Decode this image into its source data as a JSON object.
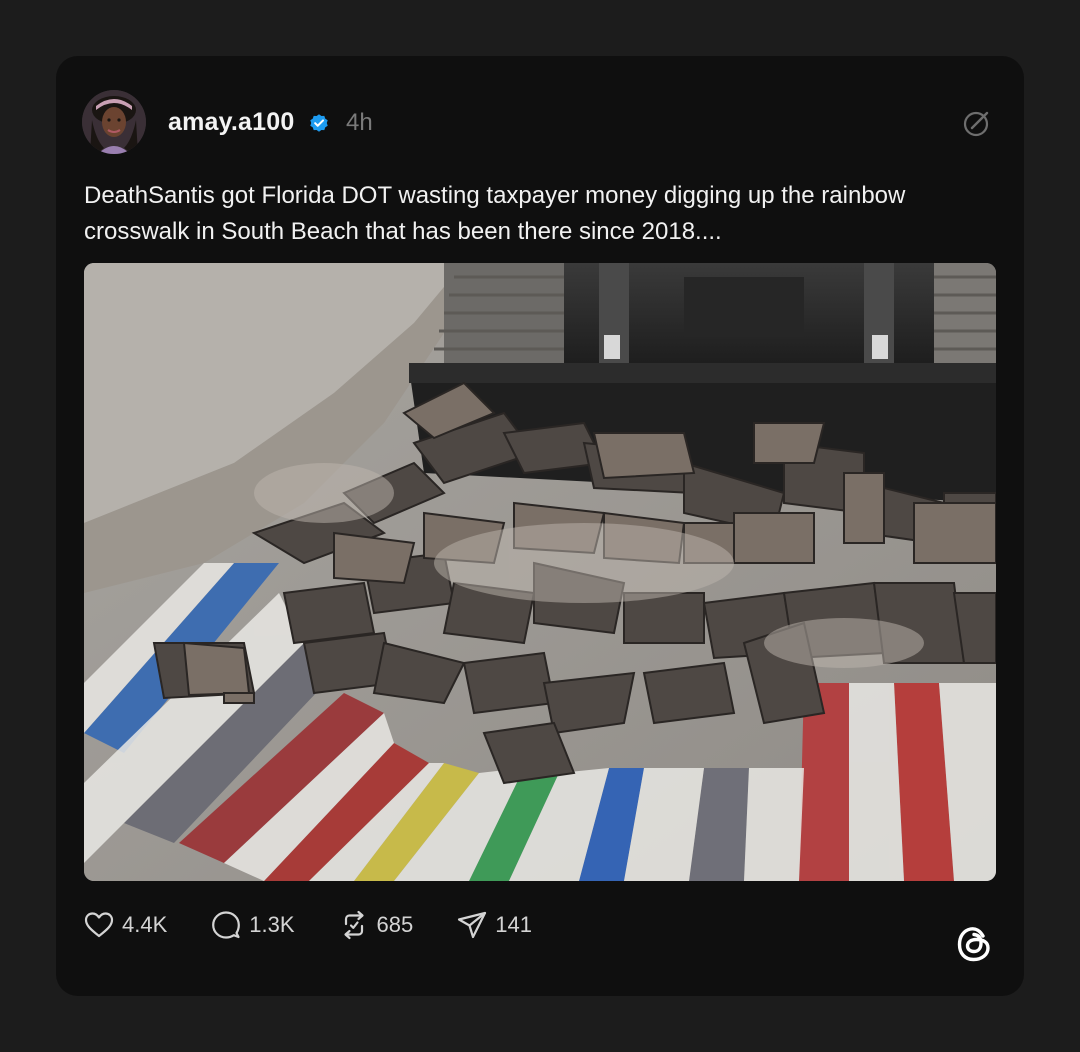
{
  "post": {
    "username": "amay.a100",
    "verified": true,
    "timestamp": "4h",
    "text": "DeathSantis got Florida DOT wasting taxpayer money digging up the rainbow crosswalk in South Beach that has been there since 2018....",
    "image_subject": "pile of rainbow crosswalk bricks in front of a bulldozer bucket"
  },
  "actions": {
    "likes": "4.4K",
    "replies": "1.3K",
    "reposts": "685",
    "shares": "141"
  },
  "icons": {
    "like": "heart-icon",
    "reply": "speech-bubble-icon",
    "repost": "repost-icon",
    "share": "paper-plane-icon",
    "more": "edit-slash-icon",
    "brand": "threads-logo-icon",
    "verified": "verified-badge-icon"
  },
  "colors": {
    "page_background": "#1c1c1c",
    "card_background": "#0f0f0f",
    "verified_blue": "#1d9bf0",
    "text_primary": "#f1f1f1",
    "text_muted": "#7a7a7a"
  }
}
